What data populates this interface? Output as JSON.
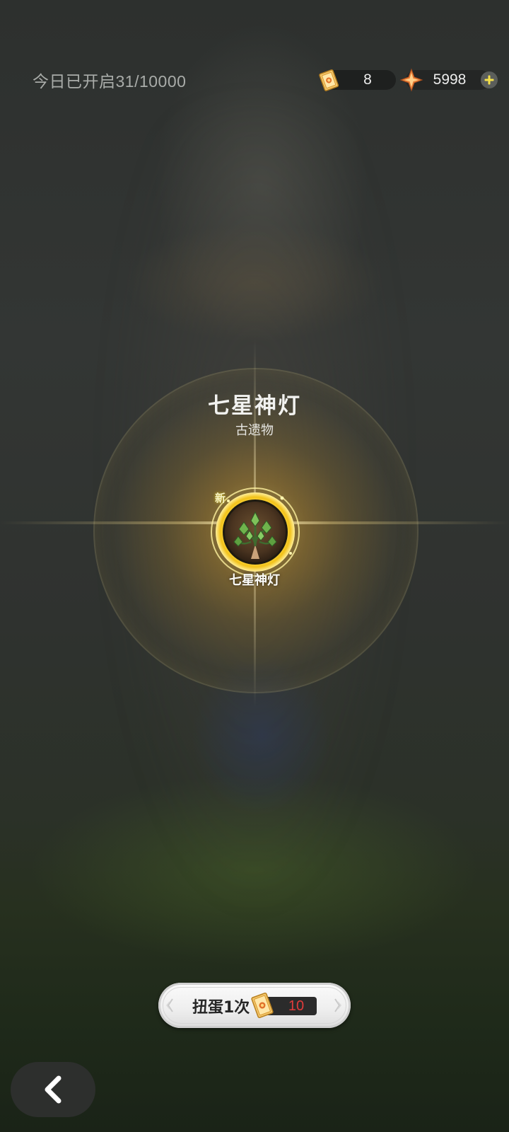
{
  "header": {
    "daily_opened": "今日已开启31/10000",
    "tickets": "8",
    "gems": "5998"
  },
  "reward": {
    "title": "七星神灯",
    "category": "古遗物",
    "new_badge": "新",
    "item_name": "七星神灯"
  },
  "gacha": {
    "label": "扭蛋1次",
    "cost": "10"
  },
  "icons": {
    "ticket": "ticket-icon",
    "gem": "star-gem-icon",
    "add": "plus-icon",
    "back": "chevron-left-icon"
  },
  "colors": {
    "accent_gold": "#f2c21a",
    "cost_red": "#e23b3b",
    "plus_yellow": "#f4e14a"
  }
}
